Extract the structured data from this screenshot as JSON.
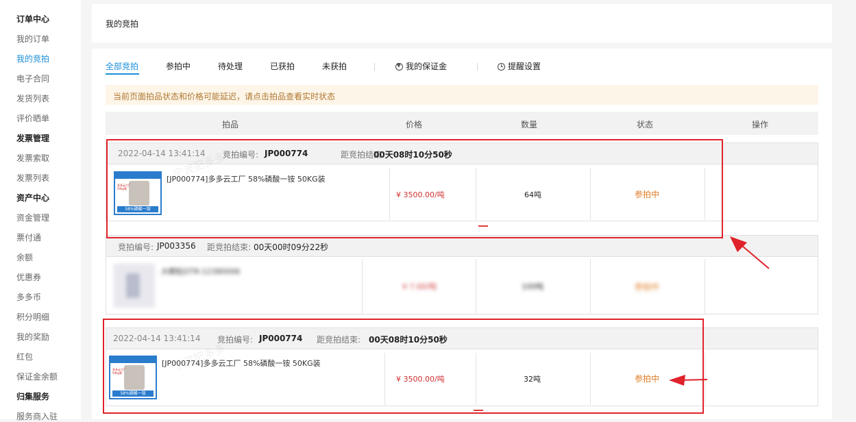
{
  "sidebar": {
    "items": [
      {
        "label": "订单中心",
        "kind": "head"
      },
      {
        "label": "我的订单",
        "kind": "item"
      },
      {
        "label": "我的竞拍",
        "kind": "active"
      },
      {
        "label": "电子合同",
        "kind": "item"
      },
      {
        "label": "发货列表",
        "kind": "item"
      },
      {
        "label": "评价晒单",
        "kind": "item"
      },
      {
        "label": "发票管理",
        "kind": "head"
      },
      {
        "label": "发票索取",
        "kind": "item"
      },
      {
        "label": "发票列表",
        "kind": "item"
      },
      {
        "label": "资产中心",
        "kind": "head"
      },
      {
        "label": "资金管理",
        "kind": "item"
      },
      {
        "label": "票付通",
        "kind": "item"
      },
      {
        "label": "余额",
        "kind": "item"
      },
      {
        "label": "优惠券",
        "kind": "item"
      },
      {
        "label": "多多币",
        "kind": "item"
      },
      {
        "label": "积分明细",
        "kind": "item"
      },
      {
        "label": "我的奖励",
        "kind": "item"
      },
      {
        "label": "红包",
        "kind": "item"
      },
      {
        "label": "保证金余额",
        "kind": "item"
      },
      {
        "label": "归集服务",
        "kind": "head"
      },
      {
        "label": "服务商入驻",
        "kind": "item"
      }
    ]
  },
  "page_title": "我的竞拍",
  "tabs": [
    "全部竞拍",
    "参拍中",
    "待处理",
    "已获拍",
    "未获拍"
  ],
  "deposit_link": "我的保证金",
  "remind_link": "提醒设置",
  "notice": "当前页面拍品状态和价格可能延迟，请点击拍品查看实时状态",
  "table_headers": [
    "拍品",
    "价格",
    "数量",
    "状态",
    "操作"
  ],
  "auctions": [
    {
      "time": "2022-04-14 13:41:14",
      "no_label": "竞拍编号:",
      "no": "JP000774",
      "end_label": "距竞拍结束:",
      "countdown": "00天08时10分50秒",
      "product": "[JP000774]多多云工厂 58%磷酸一铵 50KG装",
      "price": "¥ 3500.00/吨",
      "qty": "64吨",
      "status": "参拍中"
    },
    {
      "time": "",
      "no_label": "竞拍编号:",
      "no": "JP003356",
      "end_label": "距竞拍结束:",
      "countdown": "00天00时09分22秒",
      "product": "大颗粒DTR-12380006",
      "price": "¥ 7.00/吨",
      "qty": "100吨",
      "status": "参拍中"
    },
    {
      "time": "2022-04-14 13:41:14",
      "no_label": "竞拍编号:",
      "no": "JP000774",
      "end_label": "距竞拍结束:",
      "countdown": "00天08时10分50秒",
      "product": "[JP000774]多多云工厂 58%磷酸一铵 50KG装",
      "price": "¥ 3500.00/吨",
      "qty": "32吨",
      "status": "参拍中"
    }
  ],
  "product_image": {
    "brand_text": "多多云工厂 50kg装",
    "band_text": "58%磷酸一铵"
  },
  "watermark": "宁波肥多多"
}
